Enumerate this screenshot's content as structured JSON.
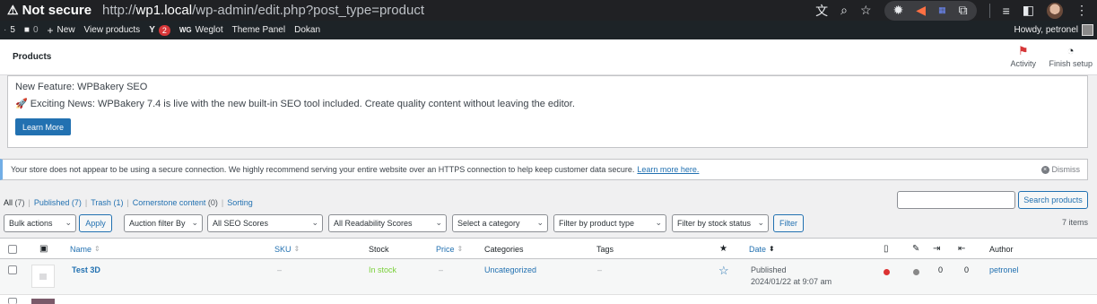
{
  "browser": {
    "security_label": "Not secure",
    "url_scheme": "http://",
    "url_host": "wp1.local",
    "url_path": "/wp-admin/edit.php?post_type=product"
  },
  "adminbar": {
    "updates_count": "5",
    "comments_count": "0",
    "new_label": "New",
    "view_products_label": "View products",
    "notification_count": "2",
    "weglot_label": "Weglot",
    "theme_panel_label": "Theme Panel",
    "dokan_label": "Dokan",
    "howdy_label": "Howdy, petronel"
  },
  "page": {
    "title": "Products",
    "activity_label": "Activity",
    "finish_setup_label": "Finish setup"
  },
  "wpbakery_notice": {
    "heading_cut": "New Feature: WPBakery SEO",
    "message": "🚀 Exciting News: WPBakery 7.4 is live with the new built-in SEO tool included. Create quality content without leaving the editor.",
    "button_label": "Learn More"
  },
  "secure_notice": {
    "message": "Your store does not appear to be using a secure connection. We highly recommend serving your entire website over an HTTPS connection to help keep customer data secure.",
    "link_label": "Learn more here.",
    "dismiss_label": "Dismiss"
  },
  "views": {
    "all_label": "All",
    "all_count": "(7)",
    "published_label": "Published",
    "published_count": "(7)",
    "trash_label": "Trash",
    "trash_count": "(1)",
    "cornerstone_label": "Cornerstone content",
    "cornerstone_count": "(0)",
    "sorting_label": "Sorting"
  },
  "search": {
    "placeholder": "",
    "button_label": "Search products"
  },
  "filters": {
    "bulk_actions": "Bulk actions",
    "apply_label": "Apply",
    "auction_filter": "Auction filter By",
    "seo_scores": "All SEO Scores",
    "readability_scores": "All Readability Scores",
    "category": "Select a category",
    "product_type": "Filter by product type",
    "stock_status": "Filter by stock status",
    "filter_label": "Filter",
    "items_count": "7 items"
  },
  "table": {
    "headers": {
      "name": "Name",
      "sku": "SKU",
      "stock": "Stock",
      "price": "Price",
      "categories": "Categories",
      "tags": "Tags",
      "date": "Date",
      "author": "Author"
    },
    "rows": [
      {
        "name": "Test 3D",
        "sku": "–",
        "stock": "In stock",
        "price": "–",
        "categories": "Uncategorized",
        "tags": "–",
        "status": "Published",
        "date": "2024/01/22 at 9:07 am",
        "seo_color": "#dc3232",
        "readability_color": "#888888",
        "links_out": "0",
        "links_in": "0",
        "author": "petronel"
      }
    ]
  },
  "colors": {
    "accent": "#2271b1",
    "in_stock": "#7ad03a",
    "admin_bar": "#1d2327"
  }
}
